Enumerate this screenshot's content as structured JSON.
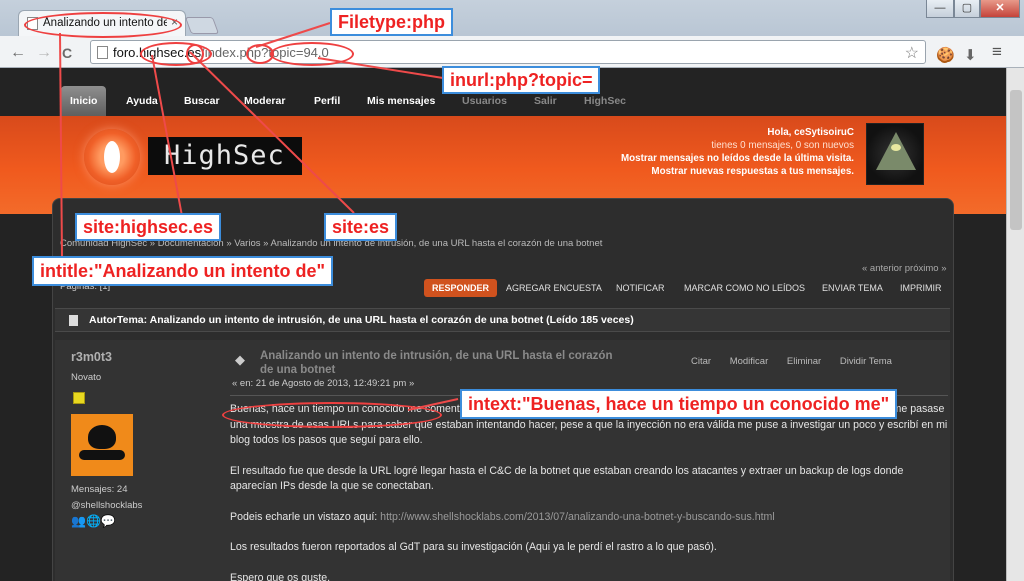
{
  "browser": {
    "tab_title": "Analizando un intento de",
    "tab_close": "×",
    "url_plain_prefix": "foro.",
    "url_domain": "highsec.es",
    "url_rest": "/index.php?topic=94.0",
    "back": "←",
    "forward": "→",
    "reload": "C",
    "star": "☆",
    "window_min": "—",
    "window_max": "▢",
    "window_close": "✕"
  },
  "forum": {
    "menu": [
      "Inicio",
      "Ayuda",
      "Buscar",
      "Moderar",
      "Perfil",
      "Mis mensajes",
      "Usuarios",
      "Salir",
      "HighSec"
    ],
    "brand": "HighSec",
    "user": {
      "greeting": "Hola, ceSytisoiruC",
      "messages": "tienes 0 mensajes, 0 son nuevos",
      "unread_link": "Mostrar mensajes no leídos desde la última visita.",
      "replies_link": "Mostrar nuevas respuestas a tus mensajes."
    },
    "breadcrumb": "Comunidad HighSec » Documentación » Varios » Analizando un intento de intrusión, de una URL hasta el corazón de una botnet",
    "prev_next": "« anterior próximo »",
    "pages": "Páginas: [1]",
    "actions": {
      "reply": "RESPONDER",
      "poll": "AGREGAR ENCUESTA",
      "notify": "NOTIFICAR",
      "mark_unread": "MARCAR COMO NO LEÍDOS",
      "send_topic": "ENVIAR TEMA",
      "print": "IMPRIMIR"
    },
    "topic_header": "AutorTema: Analizando un intento de intrusión, de una URL hasta el corazón de una botnet  (Leído 185 veces)",
    "post": {
      "author": "r3m0t3",
      "rank": "Novato",
      "posts_count": "Mensajes: 24",
      "handle": "@shellshocklabs",
      "title": "Analizando un intento de intrusión, de una URL hasta el corazón de una botnet",
      "date": "« en: 21 de Agosto de 2013, 12:49:21 pm »",
      "quote": "Citar",
      "modify": "Modificar",
      "delete": "Eliminar",
      "split": "Dividir Tema",
      "body_1": "Buenas, hace un tiempo un conocido me comentó que en los logs de su servidor había detectado algunos intentos de inyección y le dije que me pasase una muestra de esas URLs para saber que estaban intentando hacer, pese a que la inyección no era válida me puse a investigar un poco y escribí en mi blog todos los pasos que seguí para ello.",
      "body_2": "El resultado fue que desde la URL logré llegar hasta el C&C de la botnet que estaban creando los atacantes y extraer un backup de logs donde aparecían IPs desde la que se conectaban.",
      "body_3_prefix": "Podeis echarle un vistazo aquí: ",
      "body_3_link": "http://www.shellshocklabs.com/2013/07/analizando-una-botnet-y-buscando-sus.html",
      "body_4": "Los resultados fueron reportados al GdT para su investigación (Aqui ya le perdí el rastro a lo que pasó).",
      "body_5": "Espero que os guste."
    }
  },
  "annotations": {
    "filetype": "Filetype:php",
    "inurl": "inurl:php?topic=",
    "site_domain": "site:highsec.es",
    "site_tld": "site:es",
    "intitle": "intitle:\"Analizando un intento de\"",
    "intext": "intext:\"Buenas, hace un tiempo un conocido me\""
  },
  "colors": {
    "annotation_text": "#ee2222",
    "annotation_border": "#3c8ddc",
    "header_orange": "#f05a1e",
    "reply_button": "#d0521e"
  }
}
